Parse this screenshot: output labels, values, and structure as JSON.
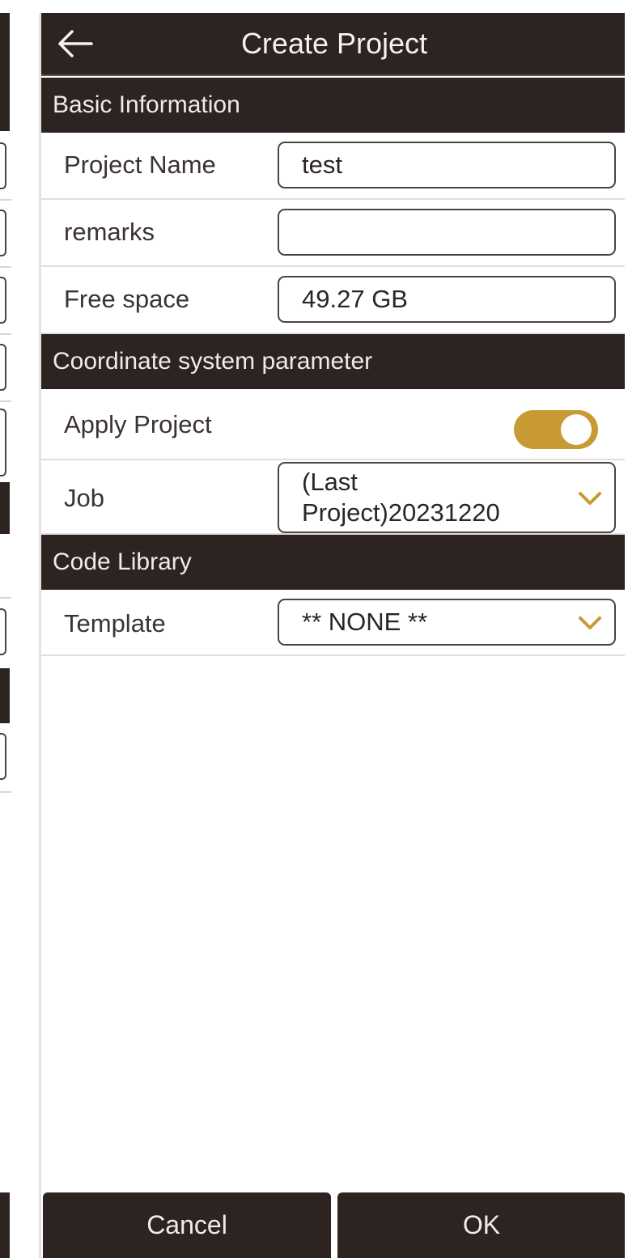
{
  "header": {
    "title": "Create Project"
  },
  "sections": {
    "basic": {
      "title": "Basic Information"
    },
    "coordinate": {
      "title": "Coordinate system parameter"
    },
    "code_library": {
      "title": "Code Library"
    }
  },
  "fields": {
    "project_name": {
      "label": "Project Name",
      "value": "test"
    },
    "remarks": {
      "label": "remarks",
      "value": ""
    },
    "free_space": {
      "label": "Free space",
      "value": "49.27 GB"
    },
    "apply_project": {
      "label": "Apply Project",
      "on": true
    },
    "job": {
      "label": "Job",
      "value_line1": "(Last",
      "value_line2": "Project)20231220"
    },
    "template": {
      "label": "Template",
      "value": "** NONE **"
    }
  },
  "buttons": {
    "cancel": "Cancel",
    "ok": "OK"
  },
  "colors": {
    "bar": "#2d2321",
    "accent": "#c79a33"
  },
  "icons": {
    "back": "arrow-left-icon",
    "dropdown": "chevron-down-icon"
  }
}
